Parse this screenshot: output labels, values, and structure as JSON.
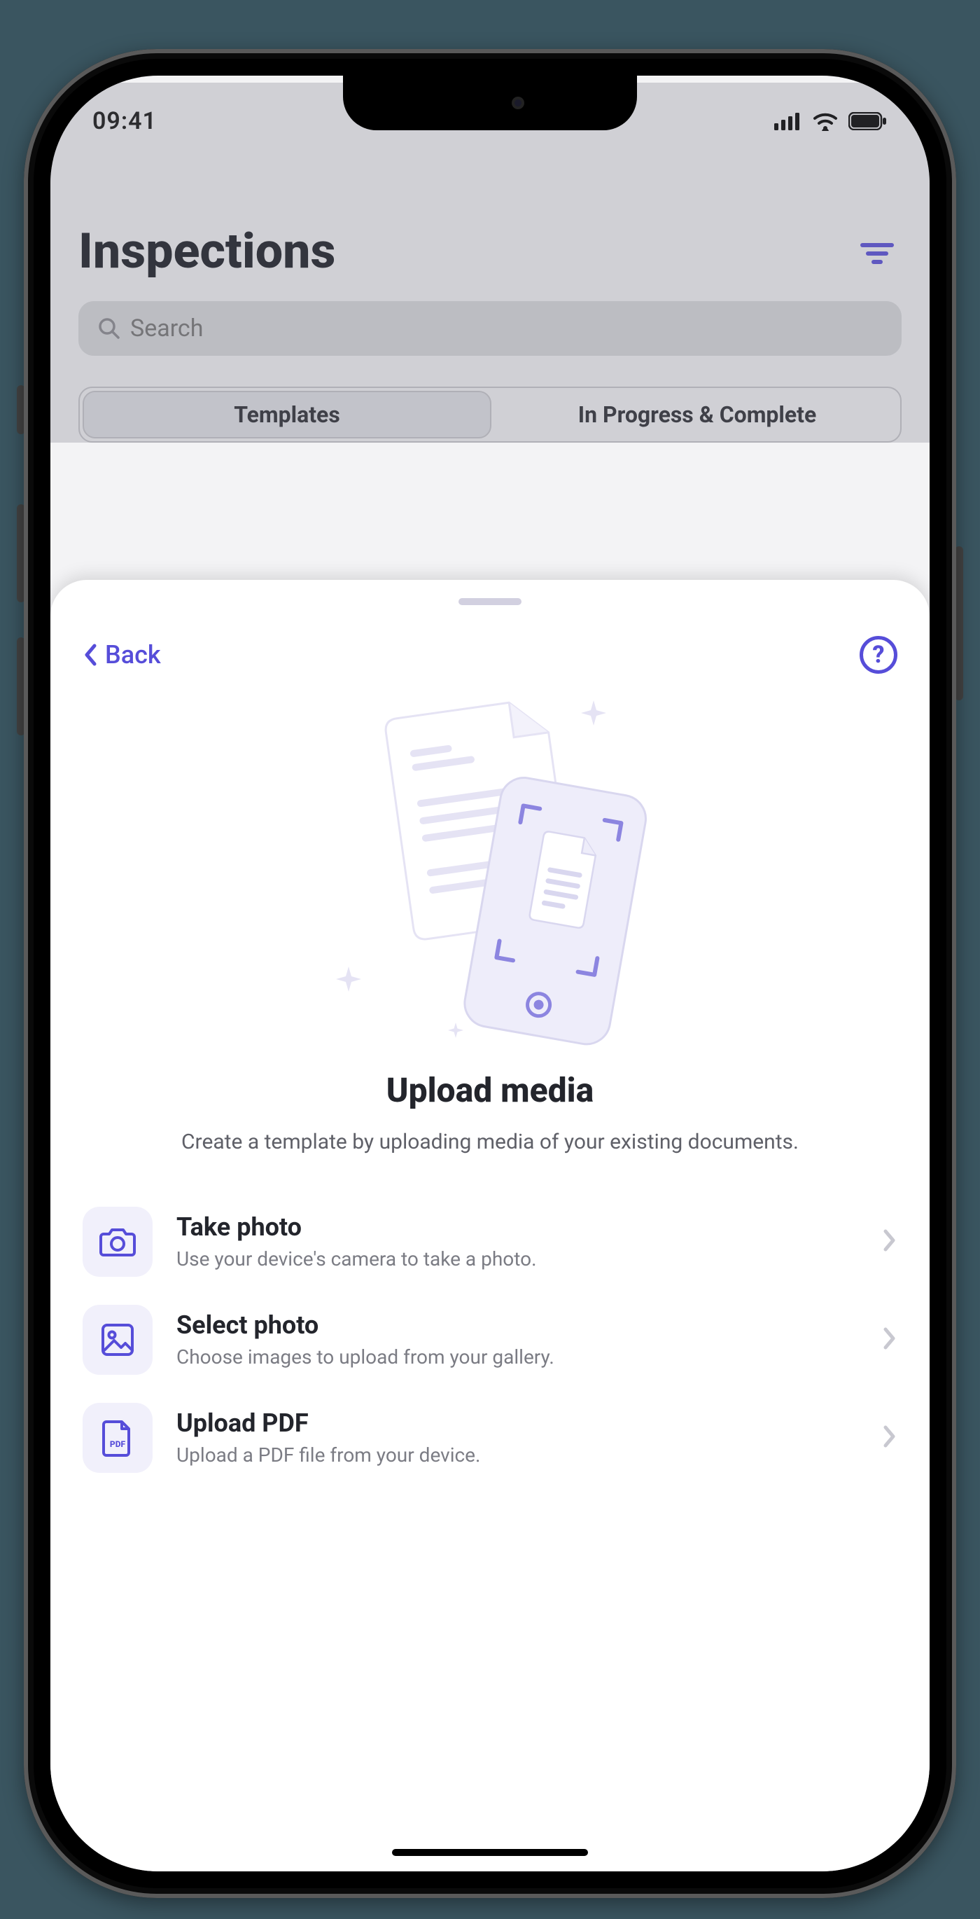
{
  "status": {
    "time": "09:41"
  },
  "underlay": {
    "page_title": "Inspections",
    "search_placeholder": "Search",
    "tabs": {
      "templates": "Templates",
      "in_progress": "In Progress & Complete"
    }
  },
  "sheet": {
    "back_label": "Back",
    "title": "Upload media",
    "subtitle": "Create a template by uploading media of your existing documents.",
    "options": [
      {
        "title": "Take photo",
        "desc": "Use your device's camera to take a photo."
      },
      {
        "title": "Select photo",
        "desc": "Choose images to upload from your gallery."
      },
      {
        "title": "Upload PDF",
        "desc": "Upload a PDF file from your device."
      }
    ],
    "pdf_badge": "PDF"
  }
}
